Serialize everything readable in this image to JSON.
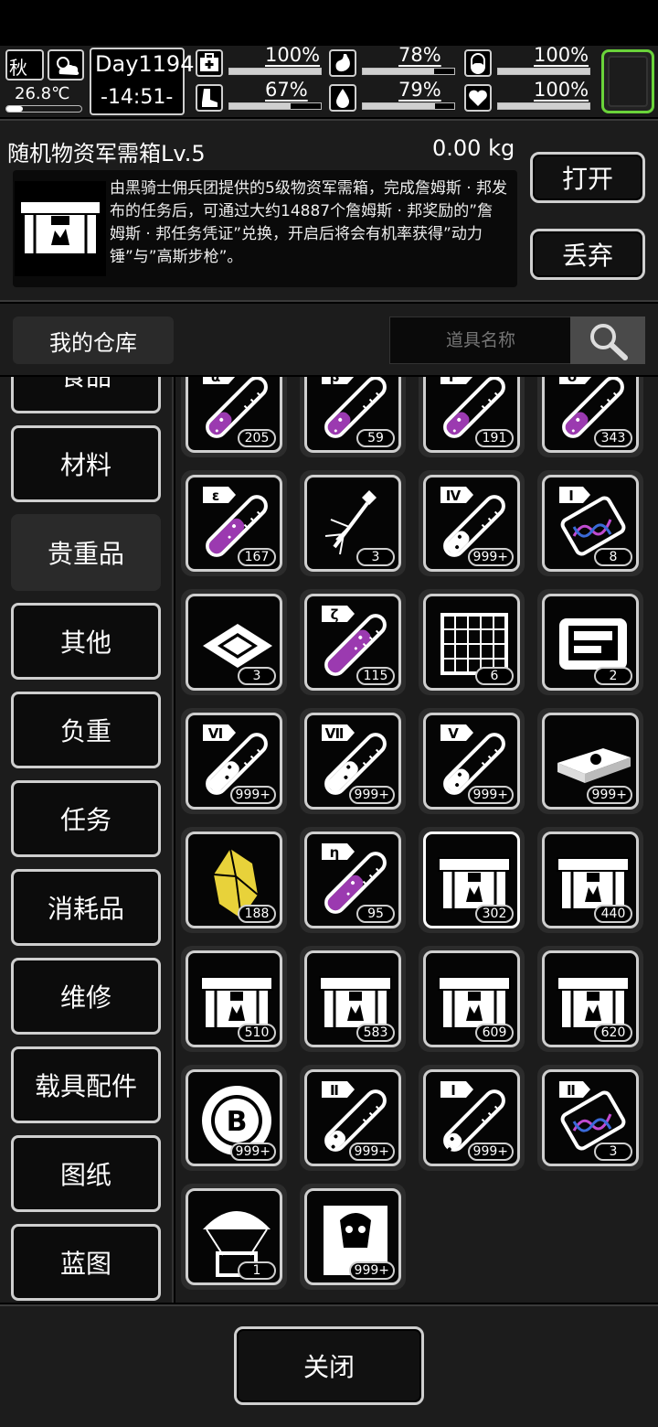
{
  "status": {
    "season": "秋",
    "temperature": "26.8℃",
    "day": "Day1194",
    "time": "-14:51-",
    "stats": [
      {
        "icon": "health-icon",
        "value": "100%",
        "fraction": 1.0
      },
      {
        "icon": "stomach-icon",
        "value": "78%",
        "fraction": 0.78
      },
      {
        "icon": "pill-icon",
        "value": "100%",
        "fraction": 1.0
      },
      {
        "icon": "boot-icon",
        "value": "67%",
        "fraction": 0.67
      },
      {
        "icon": "water-drop-icon",
        "value": "79%",
        "fraction": 0.79
      },
      {
        "icon": "heart-icon",
        "value": "100%",
        "fraction": 1.0
      }
    ]
  },
  "item": {
    "name": "随机物资军需箱Lv.5",
    "weight": "0.00 kg",
    "description": "由黑骑士佣兵团提供的5级物资军需箱，完成詹姆斯 · 邦发布的任务后，可通过大约14887个詹姆斯 · 邦奖励的”詹姆斯 · 邦任务凭证”兑换，开启后将会有机率获得”动力锤”与”高斯步枪”。",
    "open_label": "打开",
    "discard_label": "丢弃"
  },
  "storage": {
    "title": "我的仓库",
    "search_placeholder": "道具名称"
  },
  "categories": [
    "食品",
    "材料",
    "贵重品",
    "其他",
    "负重",
    "任务",
    "消耗品",
    "维修",
    "载具配件",
    "图纸",
    "蓝图"
  ],
  "active_category": "贵重品",
  "items": [
    {
      "icon": "tube-alpha-icon",
      "label": "α",
      "kind": "tube",
      "fill": 0.35,
      "color": "#9b3ab0",
      "count": "205"
    },
    {
      "icon": "tube-beta-icon",
      "label": "β",
      "kind": "tube",
      "fill": 0.35,
      "color": "#9b3ab0",
      "count": "59"
    },
    {
      "icon": "tube-f-icon",
      "label": "F",
      "kind": "tube",
      "fill": 0.35,
      "color": "#9b3ab0",
      "count": "191"
    },
    {
      "icon": "tube-delta-icon",
      "label": "δ",
      "kind": "tube",
      "fill": 0.35,
      "color": "#9b3ab0",
      "count": "343"
    },
    {
      "icon": "tube-epsilon-icon",
      "label": "ε",
      "kind": "tube",
      "fill": 0.6,
      "color": "#9b3ab0",
      "count": "167"
    },
    {
      "icon": "nanobot-icon",
      "label": "",
      "kind": "bot",
      "count": "3"
    },
    {
      "icon": "tube-iv-icon",
      "label": "Ⅳ",
      "kind": "tube",
      "fill": 0.35,
      "color": "#ffffff",
      "count": "999+"
    },
    {
      "icon": "dna-capsule-i-icon",
      "label": "I",
      "kind": "dna",
      "count": "8"
    },
    {
      "icon": "microchip-icon",
      "label": "",
      "kind": "chip",
      "count": "3"
    },
    {
      "icon": "tube-zeta-icon",
      "label": "ζ",
      "kind": "tube",
      "fill": 0.75,
      "color": "#9b3ab0",
      "count": "115"
    },
    {
      "icon": "grid-plate-icon",
      "label": "",
      "kind": "plate",
      "count": "6"
    },
    {
      "icon": "generator-icon",
      "label": "",
      "kind": "gen",
      "count": "2"
    },
    {
      "icon": "tube-vi-icon",
      "label": "Ⅵ",
      "kind": "tube",
      "fill": 0.5,
      "color": "#ffffff",
      "count": "999+"
    },
    {
      "icon": "tube-vii-icon",
      "label": "Ⅶ",
      "kind": "tube",
      "fill": 0.5,
      "color": "#ffffff",
      "count": "999+"
    },
    {
      "icon": "tube-v-icon",
      "label": "Ⅴ",
      "kind": "tube",
      "fill": 0.35,
      "color": "#ffffff",
      "count": "999+"
    },
    {
      "icon": "cash-stack-icon",
      "label": "",
      "kind": "cash",
      "count": "999+"
    },
    {
      "icon": "gold-crystal-icon",
      "label": "",
      "kind": "crystal",
      "count": "188"
    },
    {
      "icon": "tube-eta-icon",
      "label": "η",
      "kind": "tube",
      "fill": 0.6,
      "color": "#9b3ab0",
      "count": "95"
    },
    {
      "icon": "supply-crate-v-icon",
      "label": "",
      "kind": "crate",
      "count": "302",
      "selected": true
    },
    {
      "icon": "locked-crate-icon",
      "label": "",
      "kind": "crate",
      "count": "440"
    },
    {
      "icon": "supply-crate-iv-icon",
      "label": "",
      "kind": "crate",
      "count": "510"
    },
    {
      "icon": "supply-crate-iii-icon",
      "label": "",
      "kind": "crate",
      "count": "583"
    },
    {
      "icon": "supply-crate-i-icon",
      "label": "",
      "kind": "crate",
      "count": "609"
    },
    {
      "icon": "supply-crate-ii-icon",
      "label": "",
      "kind": "crate",
      "count": "620"
    },
    {
      "icon": "bitcoin-chip-icon",
      "label": "",
      "kind": "coin",
      "count": "999+"
    },
    {
      "icon": "tube-ii-icon",
      "label": "Ⅱ",
      "kind": "tube",
      "fill": 0.25,
      "color": "#ffffff",
      "count": "999+"
    },
    {
      "icon": "tube-i-icon",
      "label": "I",
      "kind": "tube",
      "fill": 0.2,
      "color": "#ffffff",
      "count": "999+"
    },
    {
      "icon": "dna-capsule-ii-icon",
      "label": "Ⅱ",
      "kind": "dna",
      "count": "3"
    },
    {
      "icon": "airdrop-vehicle-icon",
      "label": "",
      "kind": "airdrop",
      "count": "1"
    },
    {
      "icon": "zombie-card-icon",
      "label": "",
      "kind": "card",
      "count": "999+"
    }
  ],
  "bottom": {
    "close_label": "关闭"
  },
  "colors": {
    "accent_green": "#6ad33a",
    "purple_liquid": "#9b3ab0",
    "gold": "#e8d23a"
  }
}
